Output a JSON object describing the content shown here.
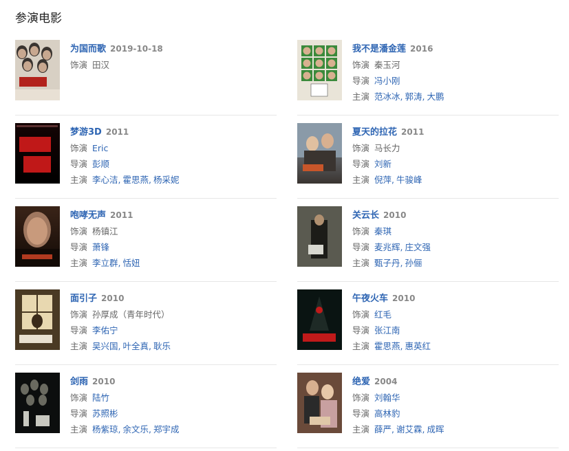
{
  "section": {
    "title": "参演电影"
  },
  "movies": [
    {
      "title": "为国而歌",
      "year": "2019-10-18",
      "role_label": "饰演",
      "role": "田汉",
      "role_link": false,
      "director_label": "",
      "directors": [],
      "cast_label": "",
      "cast": [],
      "poster": {
        "bg": "#d8d0c4",
        "accent": "#b2221c",
        "dark": "#2a2a2a",
        "kind": "faces-red"
      }
    },
    {
      "title": "我不是潘金莲",
      "year": "2016",
      "role_label": "饰演",
      "role": "秦玉河",
      "role_link": false,
      "director_label": "导演",
      "directors": [
        "冯小刚"
      ],
      "cast_label": "主演",
      "cast": [
        "范冰冰",
        "郭涛",
        "大鹏"
      ],
      "poster": {
        "bg": "#e9e4d8",
        "accent": "#3b8a3b",
        "dark": "#4a4a4a",
        "kind": "grid-faces"
      }
    },
    {
      "title": "梦游3D",
      "year": "2011",
      "role_label": "饰演",
      "role": "Eric",
      "role_link": true,
      "director_label": "导演",
      "directors": [
        "彭顺"
      ],
      "cast_label": "主演",
      "cast": [
        "李心洁",
        "霍思燕",
        "杨采妮"
      ],
      "poster": {
        "bg": "#140404",
        "accent": "#c01818",
        "dark": "#000000",
        "kind": "red-text"
      }
    },
    {
      "title": "夏天的拉花",
      "year": "2011",
      "role_label": "饰演",
      "role": "马长力",
      "role_link": false,
      "director_label": "导演",
      "directors": [
        "刘新"
      ],
      "cast_label": "主演",
      "cast": [
        "倪萍",
        "牛骏峰"
      ],
      "poster": {
        "bg": "#8a9aa8",
        "accent": "#c8562a",
        "dark": "#3a3430",
        "kind": "couple"
      }
    },
    {
      "title": "咆哮无声",
      "year": "2011",
      "role_label": "饰演",
      "role": "杨镇江",
      "role_link": false,
      "director_label": "导演",
      "directors": [
        "萧锋"
      ],
      "cast_label": "主演",
      "cast": [
        "李立群",
        "恬妞"
      ],
      "poster": {
        "bg": "#3a2418",
        "accent": "#b03a20",
        "dark": "#120a06",
        "kind": "face-dark"
      }
    },
    {
      "title": "关云长",
      "year": "2010",
      "role_label": "饰演",
      "role": "秦琪",
      "role_link": true,
      "director_label": "导演",
      "directors": [
        "麦兆辉",
        "庄文强"
      ],
      "cast_label": "主演",
      "cast": [
        "甄子丹",
        "孙俪"
      ],
      "poster": {
        "bg": "#5a5a50",
        "accent": "#d8d8d0",
        "dark": "#1c1c18",
        "kind": "warrior"
      }
    },
    {
      "title": "面引子",
      "year": "2010",
      "role_label": "饰演",
      "role": "孙厚成（青年时代）",
      "role_link": false,
      "director_label": "导演",
      "directors": [
        "李佑宁"
      ],
      "cast_label": "主演",
      "cast": [
        "吴兴国",
        "叶全真",
        "耿乐"
      ],
      "poster": {
        "bg": "#4a3a24",
        "accent": "#e8d8b0",
        "dark": "#1e160c",
        "kind": "window"
      }
    },
    {
      "title": "午夜火车",
      "year": "2010",
      "role_label": "饰演",
      "role": "红毛",
      "role_link": true,
      "director_label": "导演",
      "directors": [
        "张江南"
      ],
      "cast_label": "主演",
      "cast": [
        "霍思燕",
        "惠英红"
      ],
      "poster": {
        "bg": "#0a1412",
        "accent": "#c01a1a",
        "dark": "#000000",
        "kind": "train"
      }
    },
    {
      "title": "剑雨",
      "year": "2010",
      "role_label": "饰演",
      "role": "陆竹",
      "role_link": true,
      "director_label": "导演",
      "directors": [
        "苏照彬"
      ],
      "cast_label": "主演",
      "cast": [
        "杨紫琼",
        "余文乐",
        "郑宇成"
      ],
      "poster": {
        "bg": "#2c3030",
        "accent": "#c8c8c0",
        "dark": "#0c0e0e",
        "kind": "sword"
      }
    },
    {
      "title": "绝爱",
      "year": "2004",
      "role_label": "饰演",
      "role": "刘翰华",
      "role_link": true,
      "director_label": "导演",
      "directors": [
        "高林豹"
      ],
      "cast_label": "主演",
      "cast": [
        "薛严",
        "谢艾霖",
        "成晖"
      ],
      "poster": {
        "bg": "#6a4a3a",
        "accent": "#e0c8a8",
        "dark": "#201410",
        "kind": "couple2"
      }
    }
  ]
}
